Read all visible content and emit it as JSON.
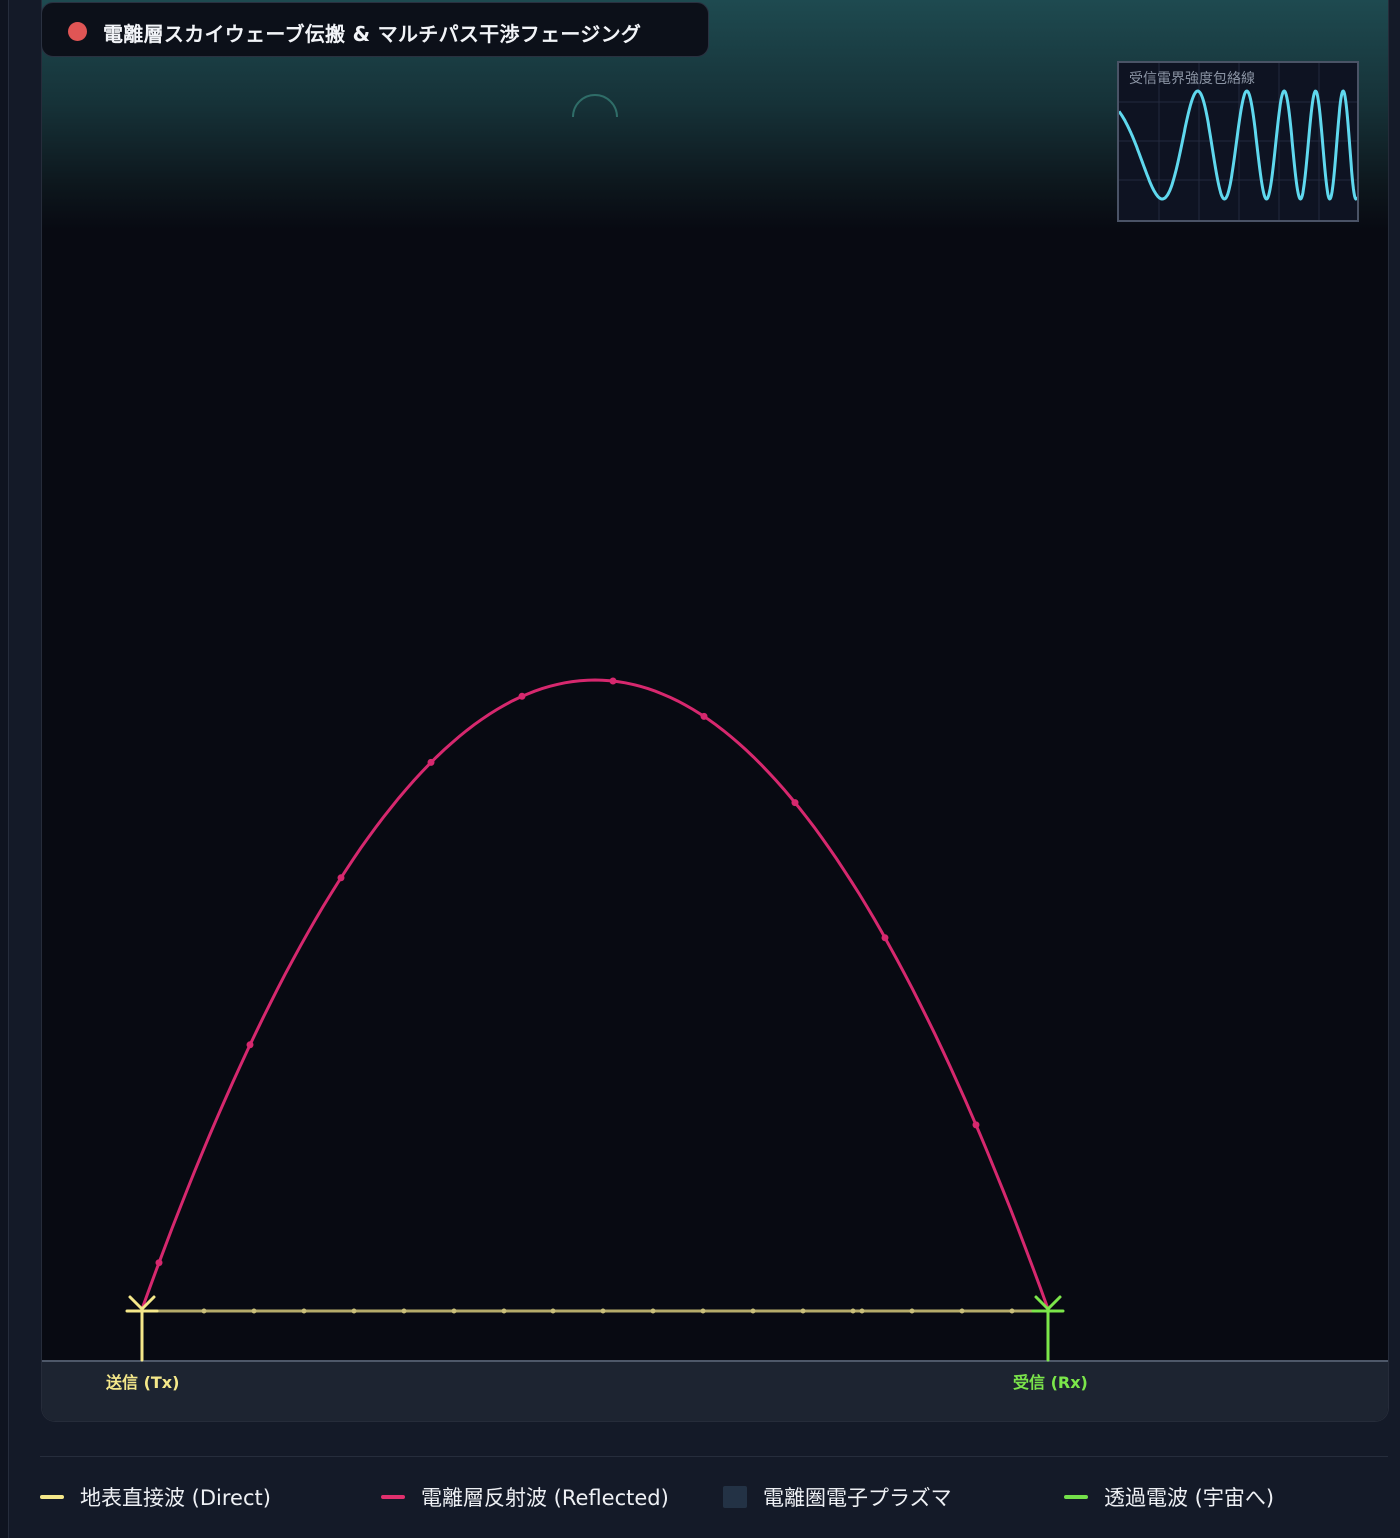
{
  "title": "電離層スカイウェーブ伝搬 & マルチパス干渉フェージング",
  "status_color": "#e05555",
  "inset": {
    "title": "受信電界強度包絡線",
    "wave_color": "#5fd8ee"
  },
  "tx": {
    "label": "送信 (Tx)",
    "color": "#f5e88a"
  },
  "rx": {
    "label": "受信 (Rx)",
    "color": "#7be64a"
  },
  "paths": {
    "direct_color": "#b5ab6a",
    "reflected_color": "#d6286e"
  },
  "legend": [
    {
      "label": "地表直接波 (Direct)",
      "color": "#f5e88a",
      "kind": "line"
    },
    {
      "label": "電離層反射波 (Reflected)",
      "color": "#e0306e",
      "kind": "line"
    },
    {
      "label": "電離圏電子プラズマ",
      "color": "#233245",
      "kind": "box"
    },
    {
      "label": "透過電波 (宇宙へ)",
      "color": "#74e04a",
      "kind": "line"
    }
  ]
}
